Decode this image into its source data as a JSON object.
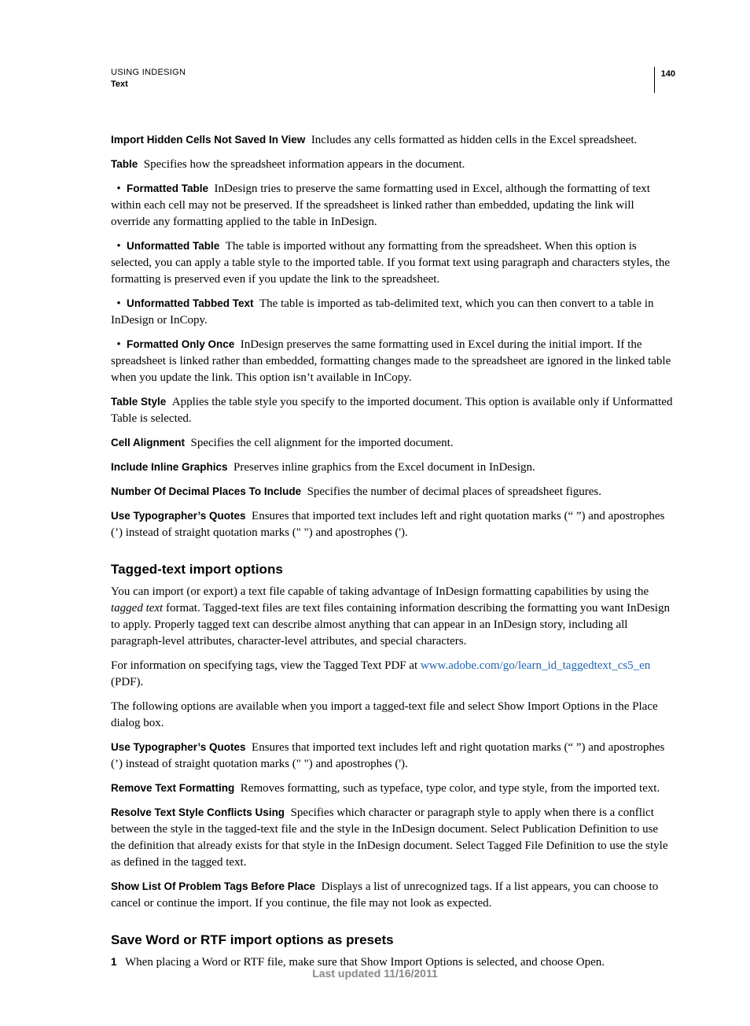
{
  "header": {
    "title": "USING INDESIGN",
    "section": "Text",
    "page_number": "140"
  },
  "defs": {
    "import_hidden_term": "Import Hidden Cells Not Saved In View",
    "import_hidden_body": "Includes any cells formatted as hidden cells in the Excel spreadsheet.",
    "table_term": "Table",
    "table_body": "Specifies how the spreadsheet information appears in the document.",
    "formatted_table_term": "Formatted Table",
    "formatted_table_body": "InDesign tries to preserve the same formatting used in Excel, although the formatting of text within each cell may not be preserved. If the spreadsheet is linked rather than embedded, updating the link will override any formatting applied to the table in InDesign.",
    "unformatted_table_term": "Unformatted Table",
    "unformatted_table_body": "The table is imported without any formatting from the spreadsheet. When this option is selected, you can apply a table style to the imported table. If you format text using paragraph and characters styles, the formatting is preserved even if you update the link to the spreadsheet.",
    "unformatted_tabbed_term": "Unformatted Tabbed Text",
    "unformatted_tabbed_body": "The table is imported as tab-delimited text, which you can then convert to a table in InDesign or InCopy.",
    "formatted_only_once_term": "Formatted Only Once",
    "formatted_only_once_body": "InDesign preserves the same formatting used in Excel during the initial import. If the spreadsheet is linked rather than embedded, formatting changes made to the spreadsheet are ignored in the linked table when you update the link. This option isn’t available in InCopy.",
    "table_style_term": "Table Style",
    "table_style_body": "Applies the table style you specify to the imported document. This option is available only if Unformatted Table is selected.",
    "cell_alignment_term": "Cell Alignment",
    "cell_alignment_body": "Specifies the cell alignment for the imported document.",
    "include_inline_term": "Include Inline Graphics",
    "include_inline_body": "Preserves inline graphics from the Excel document in InDesign.",
    "decimal_places_term": "Number Of Decimal Places To Include",
    "decimal_places_body": "Specifies the number of decimal places of spreadsheet figures.",
    "typographers_quotes_term": "Use Typographer’s Quotes",
    "typographers_quotes_body": "Ensures that imported text includes left and right quotation marks (“ ”) and apostrophes (’) instead of straight quotation marks (\" \") and apostrophes (')."
  },
  "sections": {
    "tagged_heading": "Tagged-text import options",
    "tagged_p1_a": "You can import (or export) a text file capable of taking advantage of InDesign formatting capabilities by using the ",
    "tagged_p1_italic": "tagged text",
    "tagged_p1_b": " format. Tagged-text files are text files containing information describing the formatting you want InDesign to apply. Properly tagged text can describe almost anything that can appear in an InDesign story, including all paragraph-level attributes, character-level attributes, and special characters.",
    "tagged_p2_a": "For information on specifying tags, view the Tagged Text PDF at ",
    "tagged_p2_link": "www.adobe.com/go/learn_id_taggedtext_cs5_en",
    "tagged_p2_b": " (PDF).",
    "tagged_p3": "The following options are available when you import a tagged-text file and select Show Import Options in the Place dialog box.",
    "typographers2_term": "Use Typographer’s Quotes",
    "typographers2_body": "Ensures that imported text includes left and right quotation marks (“ ”) and apostrophes (’) instead of straight quotation marks (\" \") and apostrophes (').",
    "remove_text_term": "Remove Text Formatting",
    "remove_text_body": "Removes formatting, such as typeface, type color, and type style, from the imported text.",
    "resolve_term": "Resolve Text Style Conflicts Using",
    "resolve_body": "Specifies which character or paragraph style to apply when there is a conflict between the style in the tagged-text file and the style in the InDesign document. Select Publication Definition to use the definition that already exists for that style in the InDesign document. Select Tagged File Definition to use the style as defined in the tagged text.",
    "show_list_term": "Show List Of Problem Tags Before Place",
    "show_list_body": "Displays a list of unrecognized tags. If a list appears, you can choose to cancel or continue the import. If you continue, the file may not look as expected.",
    "save_heading": "Save Word or RTF import options as presets",
    "step1_num": "1",
    "step1_body": "When placing a Word or RTF file, make sure that Show Import Options is selected, and choose Open."
  },
  "bullet": "•",
  "footer": "Last updated 11/16/2011"
}
